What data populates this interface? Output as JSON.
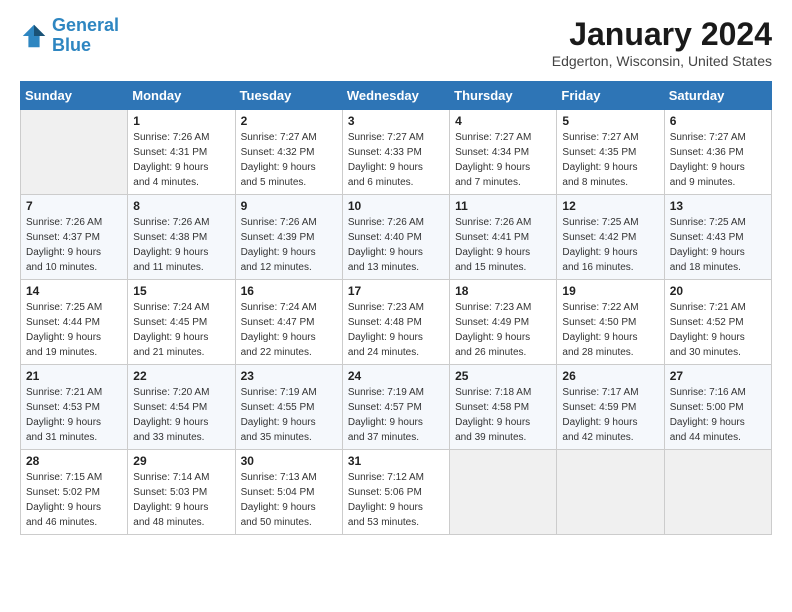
{
  "logo": {
    "line1": "General",
    "line2": "Blue"
  },
  "title": "January 2024",
  "location": "Edgerton, Wisconsin, United States",
  "days_of_week": [
    "Sunday",
    "Monday",
    "Tuesday",
    "Wednesday",
    "Thursday",
    "Friday",
    "Saturday"
  ],
  "weeks": [
    [
      {
        "day": "",
        "info": ""
      },
      {
        "day": "1",
        "info": "Sunrise: 7:26 AM\nSunset: 4:31 PM\nDaylight: 9 hours\nand 4 minutes."
      },
      {
        "day": "2",
        "info": "Sunrise: 7:27 AM\nSunset: 4:32 PM\nDaylight: 9 hours\nand 5 minutes."
      },
      {
        "day": "3",
        "info": "Sunrise: 7:27 AM\nSunset: 4:33 PM\nDaylight: 9 hours\nand 6 minutes."
      },
      {
        "day": "4",
        "info": "Sunrise: 7:27 AM\nSunset: 4:34 PM\nDaylight: 9 hours\nand 7 minutes."
      },
      {
        "day": "5",
        "info": "Sunrise: 7:27 AM\nSunset: 4:35 PM\nDaylight: 9 hours\nand 8 minutes."
      },
      {
        "day": "6",
        "info": "Sunrise: 7:27 AM\nSunset: 4:36 PM\nDaylight: 9 hours\nand 9 minutes."
      }
    ],
    [
      {
        "day": "7",
        "info": "Sunrise: 7:26 AM\nSunset: 4:37 PM\nDaylight: 9 hours\nand 10 minutes."
      },
      {
        "day": "8",
        "info": "Sunrise: 7:26 AM\nSunset: 4:38 PM\nDaylight: 9 hours\nand 11 minutes."
      },
      {
        "day": "9",
        "info": "Sunrise: 7:26 AM\nSunset: 4:39 PM\nDaylight: 9 hours\nand 12 minutes."
      },
      {
        "day": "10",
        "info": "Sunrise: 7:26 AM\nSunset: 4:40 PM\nDaylight: 9 hours\nand 13 minutes."
      },
      {
        "day": "11",
        "info": "Sunrise: 7:26 AM\nSunset: 4:41 PM\nDaylight: 9 hours\nand 15 minutes."
      },
      {
        "day": "12",
        "info": "Sunrise: 7:25 AM\nSunset: 4:42 PM\nDaylight: 9 hours\nand 16 minutes."
      },
      {
        "day": "13",
        "info": "Sunrise: 7:25 AM\nSunset: 4:43 PM\nDaylight: 9 hours\nand 18 minutes."
      }
    ],
    [
      {
        "day": "14",
        "info": "Sunrise: 7:25 AM\nSunset: 4:44 PM\nDaylight: 9 hours\nand 19 minutes."
      },
      {
        "day": "15",
        "info": "Sunrise: 7:24 AM\nSunset: 4:45 PM\nDaylight: 9 hours\nand 21 minutes."
      },
      {
        "day": "16",
        "info": "Sunrise: 7:24 AM\nSunset: 4:47 PM\nDaylight: 9 hours\nand 22 minutes."
      },
      {
        "day": "17",
        "info": "Sunrise: 7:23 AM\nSunset: 4:48 PM\nDaylight: 9 hours\nand 24 minutes."
      },
      {
        "day": "18",
        "info": "Sunrise: 7:23 AM\nSunset: 4:49 PM\nDaylight: 9 hours\nand 26 minutes."
      },
      {
        "day": "19",
        "info": "Sunrise: 7:22 AM\nSunset: 4:50 PM\nDaylight: 9 hours\nand 28 minutes."
      },
      {
        "day": "20",
        "info": "Sunrise: 7:21 AM\nSunset: 4:52 PM\nDaylight: 9 hours\nand 30 minutes."
      }
    ],
    [
      {
        "day": "21",
        "info": "Sunrise: 7:21 AM\nSunset: 4:53 PM\nDaylight: 9 hours\nand 31 minutes."
      },
      {
        "day": "22",
        "info": "Sunrise: 7:20 AM\nSunset: 4:54 PM\nDaylight: 9 hours\nand 33 minutes."
      },
      {
        "day": "23",
        "info": "Sunrise: 7:19 AM\nSunset: 4:55 PM\nDaylight: 9 hours\nand 35 minutes."
      },
      {
        "day": "24",
        "info": "Sunrise: 7:19 AM\nSunset: 4:57 PM\nDaylight: 9 hours\nand 37 minutes."
      },
      {
        "day": "25",
        "info": "Sunrise: 7:18 AM\nSunset: 4:58 PM\nDaylight: 9 hours\nand 39 minutes."
      },
      {
        "day": "26",
        "info": "Sunrise: 7:17 AM\nSunset: 4:59 PM\nDaylight: 9 hours\nand 42 minutes."
      },
      {
        "day": "27",
        "info": "Sunrise: 7:16 AM\nSunset: 5:00 PM\nDaylight: 9 hours\nand 44 minutes."
      }
    ],
    [
      {
        "day": "28",
        "info": "Sunrise: 7:15 AM\nSunset: 5:02 PM\nDaylight: 9 hours\nand 46 minutes."
      },
      {
        "day": "29",
        "info": "Sunrise: 7:14 AM\nSunset: 5:03 PM\nDaylight: 9 hours\nand 48 minutes."
      },
      {
        "day": "30",
        "info": "Sunrise: 7:13 AM\nSunset: 5:04 PM\nDaylight: 9 hours\nand 50 minutes."
      },
      {
        "day": "31",
        "info": "Sunrise: 7:12 AM\nSunset: 5:06 PM\nDaylight: 9 hours\nand 53 minutes."
      },
      {
        "day": "",
        "info": ""
      },
      {
        "day": "",
        "info": ""
      },
      {
        "day": "",
        "info": ""
      }
    ]
  ]
}
